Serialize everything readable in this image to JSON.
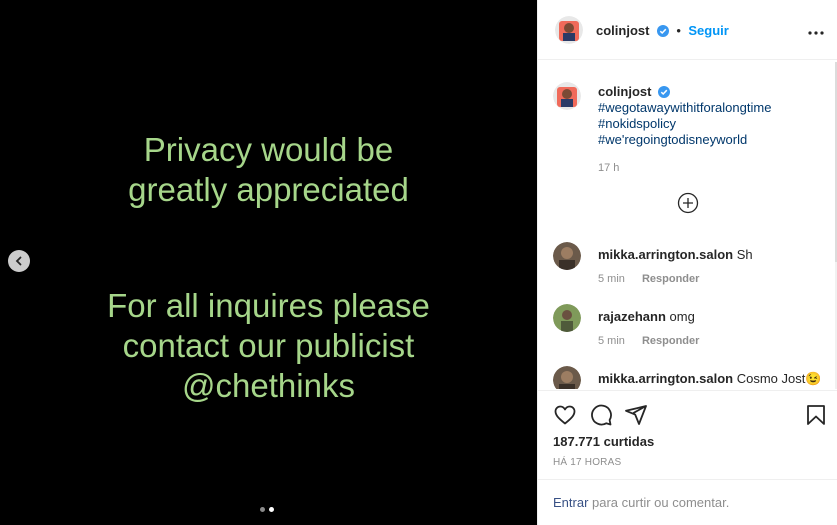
{
  "media": {
    "text_block_1": [
      "Privacy would be",
      "greatly appreciated"
    ],
    "text_block_2": [
      "For all inquires please",
      "contact our publicist",
      "@chethinks"
    ],
    "text_color": "#a6d68a",
    "background": "#000000",
    "carousel": {
      "total": 2,
      "active_index": 1
    }
  },
  "header": {
    "username": "colinjost",
    "separator": "•",
    "follow_label": "Seguir"
  },
  "caption": {
    "username": "colinjost",
    "hashtags": [
      "#wegotawaywithitforalongtime",
      "#nokidspolicy",
      "#we'regoingtodisneyworld"
    ],
    "time": "17 h"
  },
  "comments": [
    {
      "username": "mikka.arrington.salon",
      "text": "Sh",
      "time": "5 min",
      "reply_label": "Responder"
    },
    {
      "username": "rajazehann",
      "text": "omg",
      "time": "5 min",
      "reply_label": "Responder"
    },
    {
      "username": "mikka.arrington.salon",
      "text": "Cosmo Jost😉"
    }
  ],
  "actions": {
    "likes": "187.771 curtidas",
    "posted": "HÁ 17 HORAS"
  },
  "login": {
    "link": "Entrar",
    "text": " para curtir ou comentar."
  },
  "colors": {
    "link": "#0095f6",
    "hashtag": "#00376b",
    "verified": "#3897f0"
  },
  "icons": [
    "chevron-left-icon",
    "verified-icon",
    "more-icon",
    "plus-circle-icon",
    "heart-icon",
    "comment-icon",
    "share-icon",
    "bookmark-icon"
  ]
}
